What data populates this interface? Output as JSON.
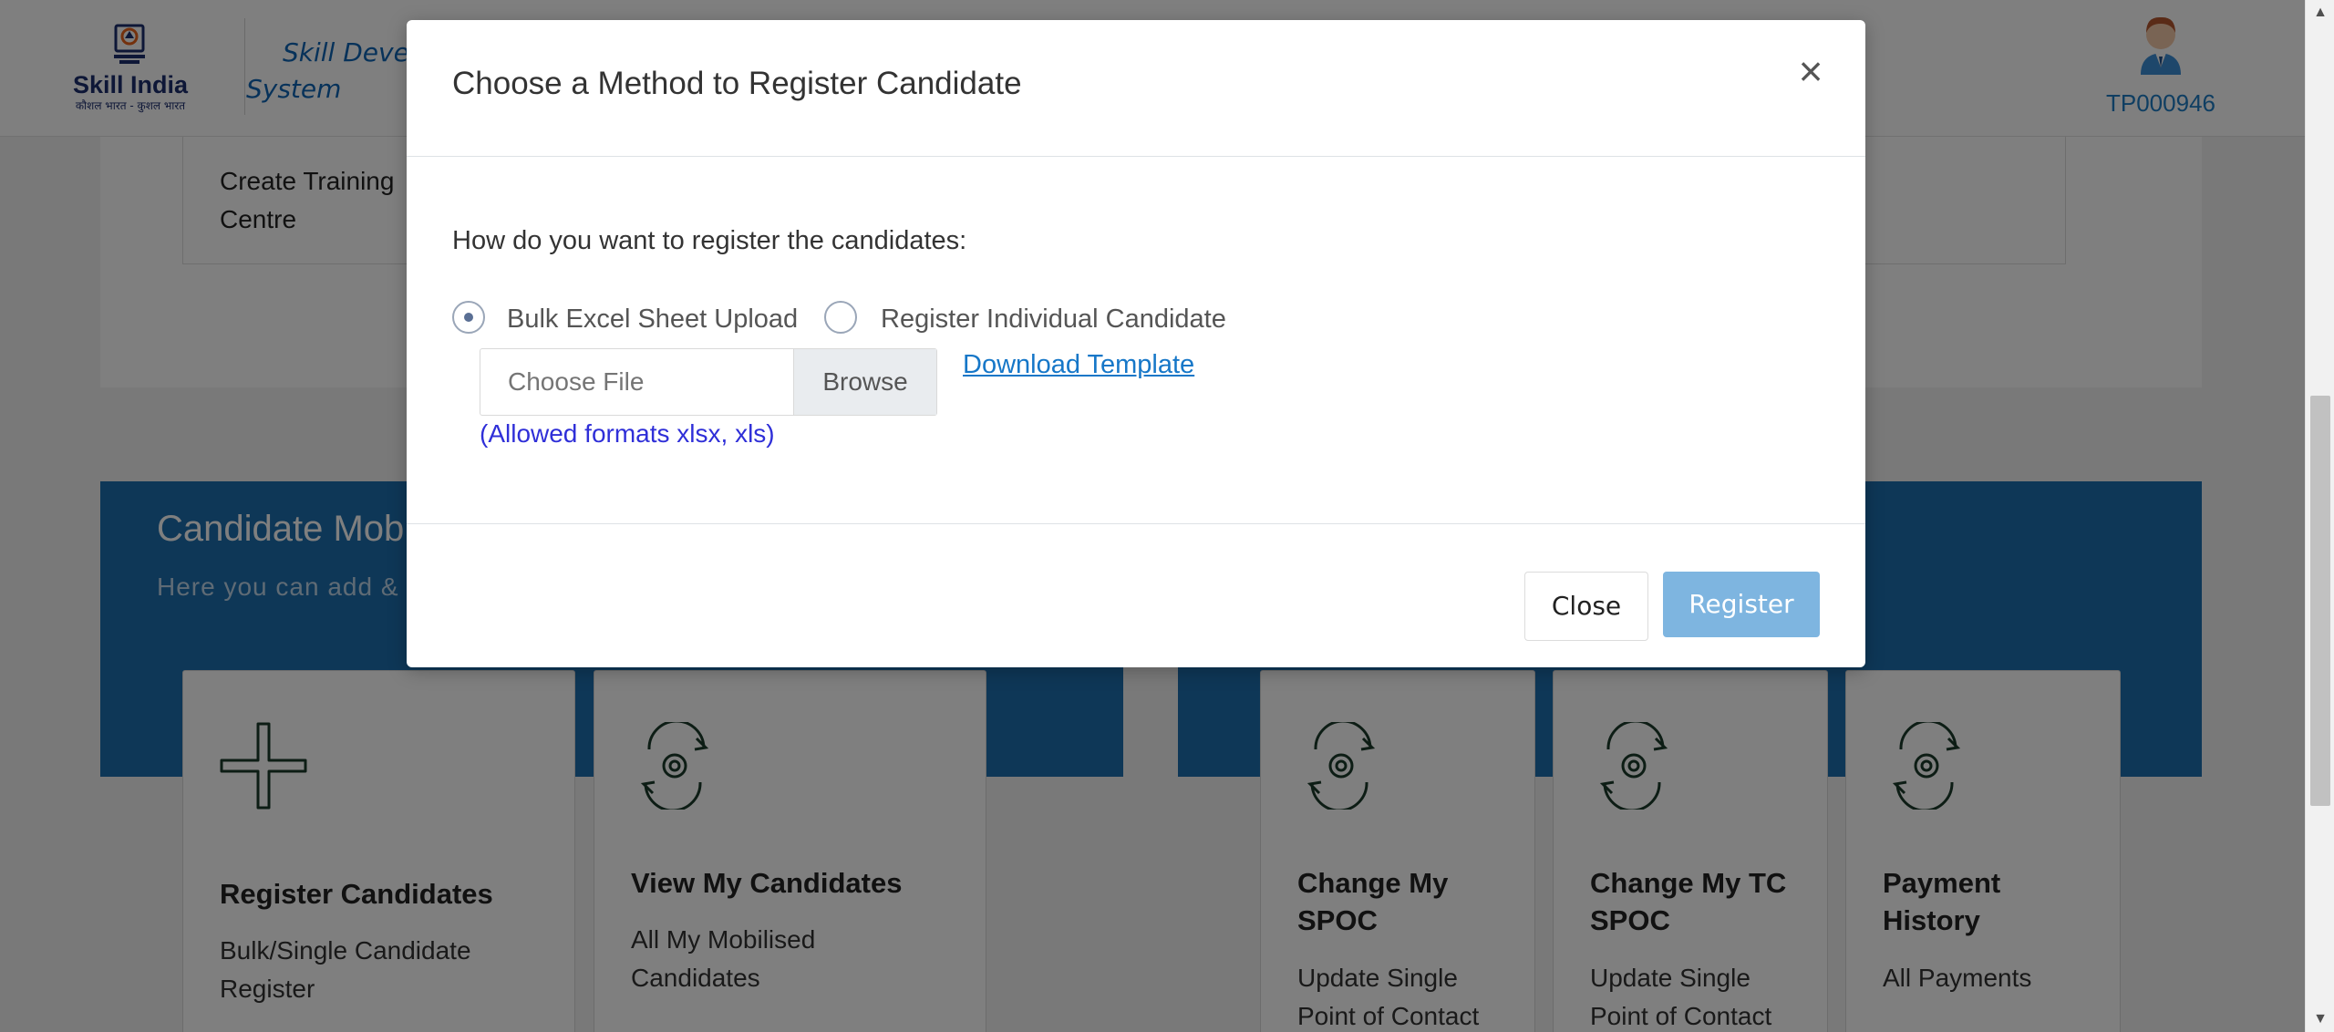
{
  "header": {
    "logo_text": "Skill India",
    "logo_tagline": "कौशल भारत - कुशल भारत",
    "system_title_line1": "Skill Devel",
    "system_title_line2": "System",
    "user_id": "TP000946"
  },
  "background": {
    "training_centre_label": "Create Training Centre",
    "banner_title": "Candidate Mob",
    "banner_subtitle": "Here you can add &",
    "tiles": [
      {
        "title": "Register Candidates",
        "desc": "Bulk/Single Candidate Register",
        "icon": "plus-icon"
      },
      {
        "title": "View My Candidates",
        "desc": "All My Mobilised Candidates",
        "icon": "gear-cycle-icon"
      },
      {
        "title": "Change My SPOC",
        "desc": "Update Single Point of Contact",
        "icon": "gear-cycle-icon"
      },
      {
        "title": "Change My TC SPOC",
        "desc": "Update Single Point of Contact",
        "icon": "gear-cycle-icon"
      },
      {
        "title": "Payment History",
        "desc": "All Payments",
        "icon": "gear-cycle-icon"
      }
    ]
  },
  "modal": {
    "title": "Choose a Method to Register Candidate",
    "close_symbol": "×",
    "question": "How do you want to register the candidates:",
    "options": [
      {
        "label": "Bulk Excel Sheet Upload",
        "selected": true
      },
      {
        "label": "Register Individual Candidate",
        "selected": false
      }
    ],
    "file_placeholder": "Choose File",
    "browse_label": "Browse",
    "download_link": "Download Template",
    "hint": "(Allowed formats xlsx, xls)",
    "close_button": "Close",
    "register_button": "Register"
  },
  "colors": {
    "banner": "#1d6fae",
    "link": "#1677c8",
    "register_button": "#7eb5e0",
    "hint": "#2f2fd8",
    "user_id": "#1f7dc4"
  }
}
